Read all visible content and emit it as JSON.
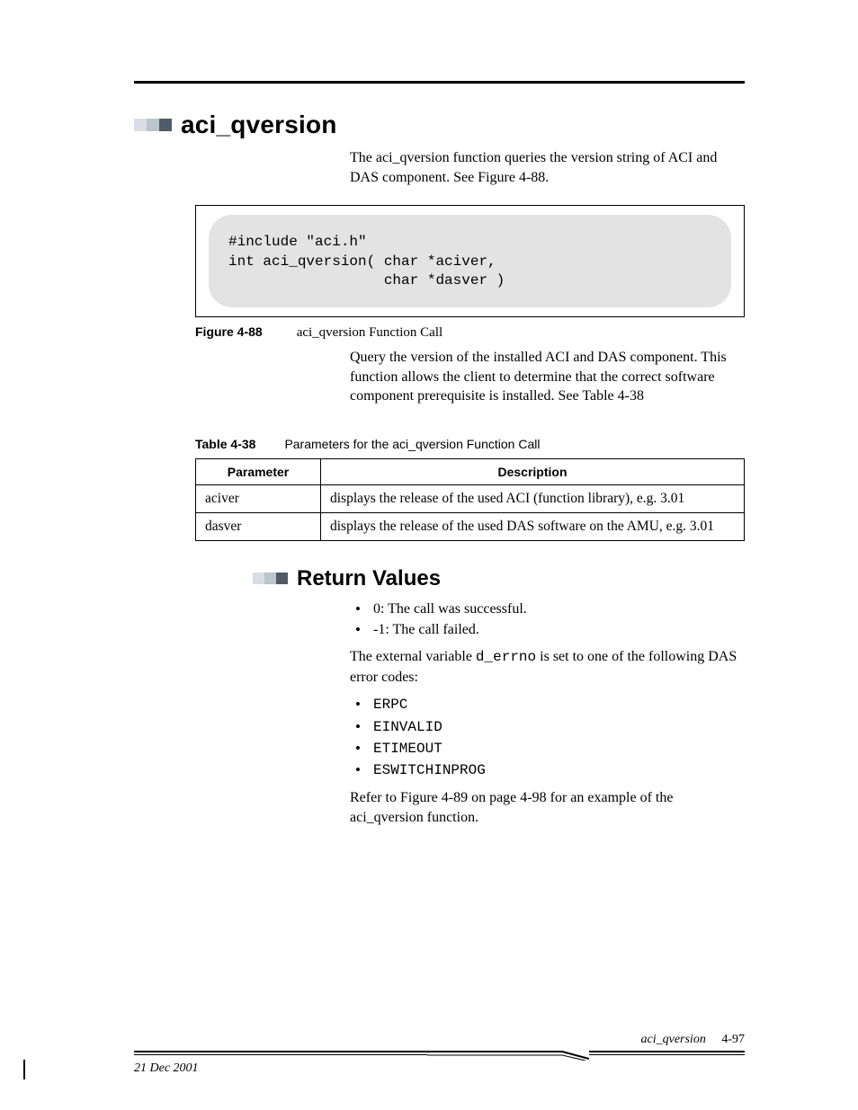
{
  "heading1": "aci_qversion",
  "intro": "The aci_qversion function queries the version string of ACI and DAS component. See Figure 4-88.",
  "code": "#include \"aci.h\"\nint aci_qversion( char *aciver,\n                  char *dasver )",
  "figure": {
    "label": "Figure 4-88",
    "title": "aci_qversion Function Call"
  },
  "after_figure": "Query the version of the installed ACI and DAS component. This function allows the client to determine that the correct software component prerequisite is installed. See Table 4-38",
  "table_caption": {
    "label": "Table 4-38",
    "title": "Parameters for the aci_qversion Function Call"
  },
  "table": {
    "headers": [
      "Parameter",
      "Description"
    ],
    "rows": [
      {
        "param": "aciver",
        "desc": "displays the release of the used ACI (function library), e.g. 3.01"
      },
      {
        "param": "dasver",
        "desc": "displays the release of the used DAS software on the AMU, e.g. 3.01"
      }
    ]
  },
  "heading2": "Return Values",
  "return_items": [
    "0: The call was successful.",
    "-1: The call failed."
  ],
  "errno_sentence_pre": "The external variable ",
  "errno_var": "d_errno",
  "errno_sentence_post": " is set to one of the following DAS error codes:",
  "error_codes": [
    "ERPC",
    "EINVALID",
    "ETIMEOUT",
    "ESWITCHINPROG"
  ],
  "see_also": "Refer to Figure 4-89 on page 4-98 for an example of the aci_qversion function.",
  "footer": {
    "section": "aci_qversion",
    "page": "4-97",
    "date": "21 Dec 2001"
  }
}
